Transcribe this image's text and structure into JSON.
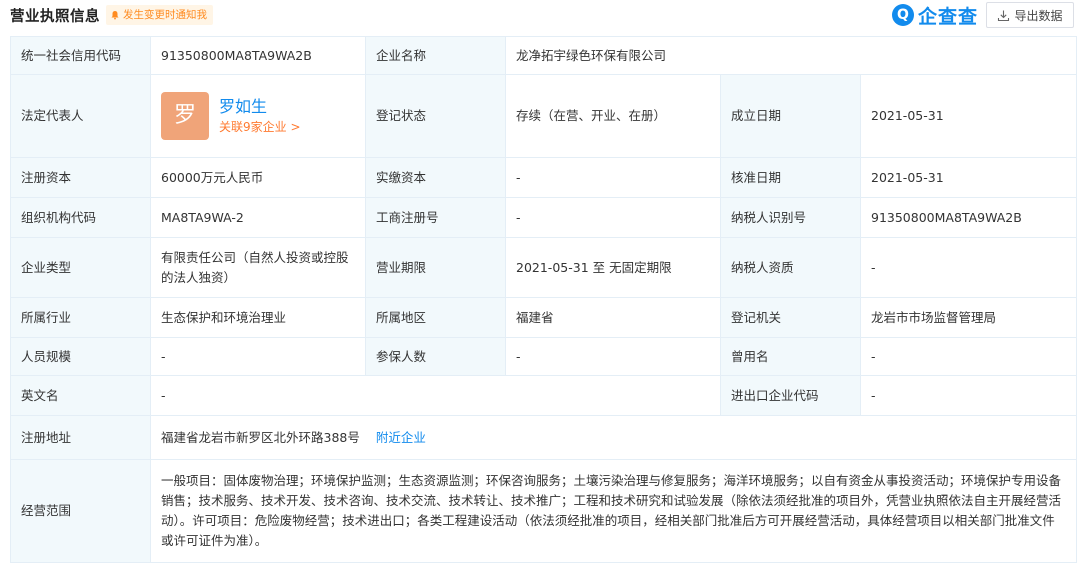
{
  "header": {
    "title": "营业执照信息",
    "notice": "发生变更时通知我",
    "logo_mark": "Q",
    "logo_text": "企查查",
    "export_label": "导出数据"
  },
  "rows": {
    "credit_code": {
      "label": "统一社会信用代码",
      "value": "91350800MA8TA9WA2B"
    },
    "company_name": {
      "label": "企业名称",
      "value": "龙净拓宇绿色环保有限公司"
    },
    "legal_rep": {
      "label": "法定代表人",
      "avatar_char": "罗",
      "name": "罗如生",
      "link": "关联9家企业 >"
    },
    "reg_status": {
      "label": "登记状态",
      "value": "存续（在营、开业、在册）"
    },
    "found_date": {
      "label": "成立日期",
      "value": "2021-05-31"
    },
    "reg_capital": {
      "label": "注册资本",
      "value": "60000万元人民币"
    },
    "paid_capital": {
      "label": "实缴资本",
      "value": "-"
    },
    "approve_date": {
      "label": "核准日期",
      "value": "2021-05-31"
    },
    "org_code": {
      "label": "组织机构代码",
      "value": "MA8TA9WA-2"
    },
    "biz_reg_no": {
      "label": "工商注册号",
      "value": "-"
    },
    "taxpayer_id": {
      "label": "纳税人识别号",
      "value": "91350800MA8TA9WA2B"
    },
    "company_type": {
      "label": "企业类型",
      "value": "有限责任公司（自然人投资或控股的法人独资）"
    },
    "biz_term": {
      "label": "营业期限",
      "value": "2021-05-31 至 无固定期限"
    },
    "taxpayer_qual": {
      "label": "纳税人资质",
      "value": "-"
    },
    "industry": {
      "label": "所属行业",
      "value": "生态保护和环境治理业"
    },
    "region": {
      "label": "所属地区",
      "value": "福建省"
    },
    "reg_authority": {
      "label": "登记机关",
      "value": "龙岩市市场监督管理局"
    },
    "staff_size": {
      "label": "人员规模",
      "value": "-"
    },
    "insured": {
      "label": "参保人数",
      "value": "-"
    },
    "former_name": {
      "label": "曾用名",
      "value": "-"
    },
    "english_name": {
      "label": "英文名",
      "value": "-"
    },
    "import_export_code": {
      "label": "进出口企业代码",
      "value": "-"
    },
    "reg_address": {
      "label": "注册地址",
      "value": "福建省龙岩市新罗区北外环路388号",
      "link": "附近企业"
    },
    "biz_scope": {
      "label": "经营范围",
      "value": "一般项目：固体废物治理；环境保护监测；生态资源监测；环保咨询服务；土壤污染治理与修复服务；海洋环境服务；以自有资金从事投资活动；环境保护专用设备销售；技术服务、技术开发、技术咨询、技术交流、技术转让、技术推广；工程和技术研究和试验发展（除依法须经批准的项目外，凭营业执照依法自主开展经营活动）。许可项目：危险废物经营；技术进出口；各类工程建设活动（依法须经批准的项目，经相关部门批准后方可开展经营活动，具体经营项目以相关部门批准文件或许可证件为准）。"
    }
  }
}
